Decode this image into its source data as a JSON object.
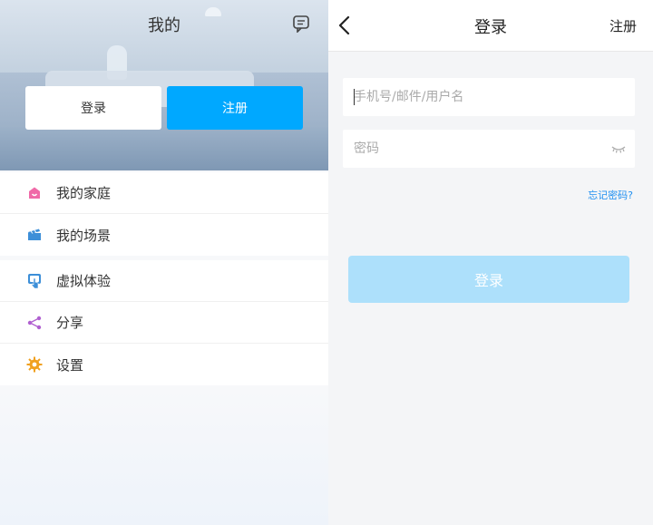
{
  "left_panel": {
    "header_title": "我的",
    "login_button": "登录",
    "register_button": "注册",
    "menu": [
      {
        "label": "我的家庭",
        "icon": "house-icon",
        "color": "#f06aa8"
      },
      {
        "label": "我的场景",
        "icon": "clapperboard-icon",
        "color": "#3d8fd8"
      },
      {
        "label": "虚拟体验",
        "icon": "touch-screen-icon",
        "color": "#3d8fd8"
      },
      {
        "label": "分享",
        "icon": "share-icon",
        "color": "#b060d0"
      },
      {
        "label": "设置",
        "icon": "gear-icon",
        "color": "#f0a020"
      }
    ]
  },
  "login_page": {
    "title": "登录",
    "register_link": "注册",
    "username_placeholder": "手机号/邮件/用户名",
    "password_placeholder": "密码",
    "forgot_password": "忘记密码?",
    "login_button": "登录"
  },
  "colors": {
    "accent": "#00a8ff",
    "login_disabled": "#ade0fb",
    "link": "#1f8ff0"
  }
}
